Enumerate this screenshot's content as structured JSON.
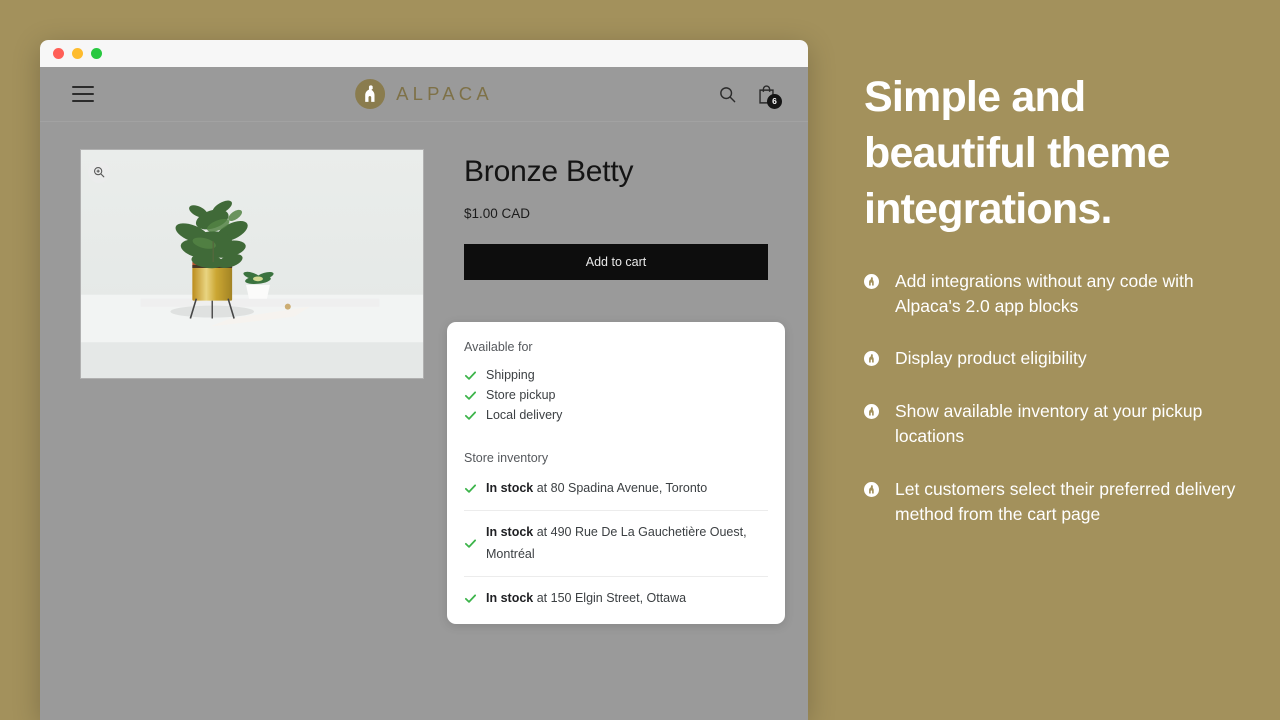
{
  "colors": {
    "background": "#a3915c",
    "overlay": "#9a9a9a",
    "brand": "#7e7147",
    "button": "#0d0d0d",
    "check": "#3cb44a",
    "card": "#ffffff"
  },
  "browser": {
    "traffic_lights": [
      "close",
      "minimize",
      "zoom"
    ]
  },
  "store": {
    "header": {
      "menu_icon": "hamburger-icon",
      "brand_name": "ALPACA",
      "logo_icon": "alpaca-mark-icon",
      "search_icon": "search-icon",
      "cart_icon": "shopping-bag-icon",
      "cart_count": "6"
    },
    "product": {
      "zoom_icon": "magnifier-plus-icon",
      "image_alt": "Potted plant in gold planter on white table",
      "title": "Bronze Betty",
      "price": "$1.00 CAD",
      "add_to_cart_label": "Add to cart"
    },
    "availability_card": {
      "available_for_title": "Available for",
      "methods": [
        {
          "label": "Shipping",
          "icon": "check-icon"
        },
        {
          "label": "Store pickup",
          "icon": "check-icon"
        },
        {
          "label": "Local delivery",
          "icon": "check-icon"
        }
      ],
      "inventory_title": "Store inventory",
      "inventory": [
        {
          "status": "In stock",
          "location": " at 80 Spadina Avenue, Toronto",
          "icon": "check-icon"
        },
        {
          "status": "In stock",
          "location": " at 490 Rue De La Gauchetière Ouest, Montréal",
          "icon": "check-icon"
        },
        {
          "status": "In stock",
          "location": " at 150 Elgin Street, Ottawa",
          "icon": "check-icon"
        }
      ]
    }
  },
  "marketing": {
    "heading": "Simple and beautiful theme integrations.",
    "features": [
      {
        "text": "Add integrations without any code with Alpaca's 2.0 app blocks",
        "icon": "alpaca-bullet-icon"
      },
      {
        "text": "Display product eligibility",
        "icon": "alpaca-bullet-icon"
      },
      {
        "text": "Show available inventory at your pickup locations",
        "icon": "alpaca-bullet-icon"
      },
      {
        "text": "Let customers select their preferred delivery method from the cart page",
        "icon": "alpaca-bullet-icon"
      }
    ]
  }
}
